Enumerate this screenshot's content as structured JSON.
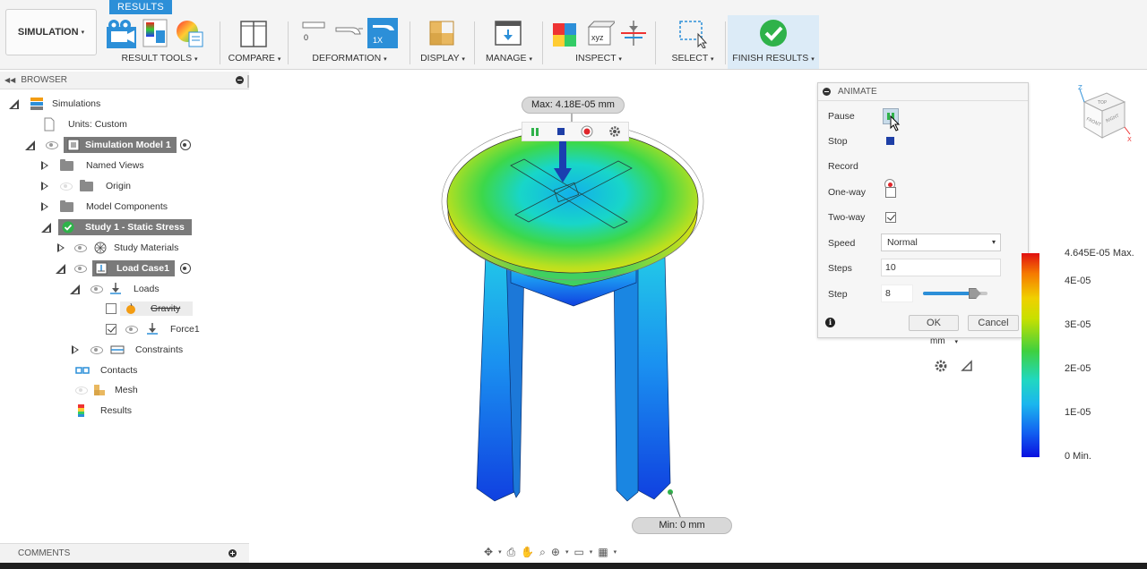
{
  "toolbar": {
    "active_tab": "RESULTS",
    "workspace": "SIMULATION",
    "groups": [
      {
        "key": "result_tools",
        "label": "RESULT TOOLS"
      },
      {
        "key": "compare",
        "label": "COMPARE"
      },
      {
        "key": "deformation",
        "label": "DEFORMATION"
      },
      {
        "key": "display",
        "label": "DISPLAY"
      },
      {
        "key": "manage",
        "label": "MANAGE"
      },
      {
        "key": "inspect",
        "label": "INSPECT"
      },
      {
        "key": "select",
        "label": "SELECT"
      },
      {
        "key": "finish_results",
        "label": "FINISH RESULTS"
      }
    ],
    "deform_zero": "0",
    "deform_scale": "1X",
    "xyz": "xyz",
    "caret": "▾"
  },
  "browser": {
    "title": "BROWSER",
    "items": [
      {
        "label": "Simulations"
      },
      {
        "label": "Units: Custom"
      },
      {
        "label": "Simulation Model 1"
      },
      {
        "label": "Named Views"
      },
      {
        "label": "Origin"
      },
      {
        "label": "Model Components"
      },
      {
        "label": "Study 1 - Static Stress"
      },
      {
        "label": "Study Materials"
      },
      {
        "label": "Load Case1"
      },
      {
        "label": "Loads"
      },
      {
        "label": "Gravity"
      },
      {
        "label": "Force1"
      },
      {
        "label": "Constraints"
      },
      {
        "label": "Contacts"
      },
      {
        "label": "Mesh"
      },
      {
        "label": "Results"
      }
    ]
  },
  "comments": {
    "title": "COMMENTS"
  },
  "viewport": {
    "max_label": "Max: 4.18E-05 mm",
    "min_label": "Min: 0 mm",
    "unit_select": "mm",
    "viewcube": {
      "top": "TOP",
      "front": "FRONT",
      "right": "RIGHT",
      "z": "Z",
      "x": "X"
    }
  },
  "animate": {
    "title": "ANIMATE",
    "pause": "Pause",
    "stop": "Stop",
    "record": "Record",
    "one_way": "One-way",
    "one_way_checked": false,
    "two_way": "Two-way",
    "two_way_checked": true,
    "speed_label": "Speed",
    "speed_value": "Normal",
    "steps_label": "Steps",
    "steps_value": "10",
    "step_label": "Step",
    "step_value": "8",
    "step_slider_fraction": 0.8,
    "ok": "OK",
    "cancel": "Cancel"
  },
  "legend": {
    "max": "4.645E-05 Max.",
    "ticks": [
      "4E-05",
      "3E-05",
      "2E-05",
      "1E-05"
    ],
    "min": "0 Min.",
    "colors": [
      "#e01010",
      "#f57a00",
      "#f0d000",
      "#3fd03f",
      "#20d8c0",
      "#1bb6ee",
      "#0a10e0"
    ]
  },
  "colors": {
    "accent_blue": "#2c8fd8",
    "finish_green": "#2fb24a"
  }
}
